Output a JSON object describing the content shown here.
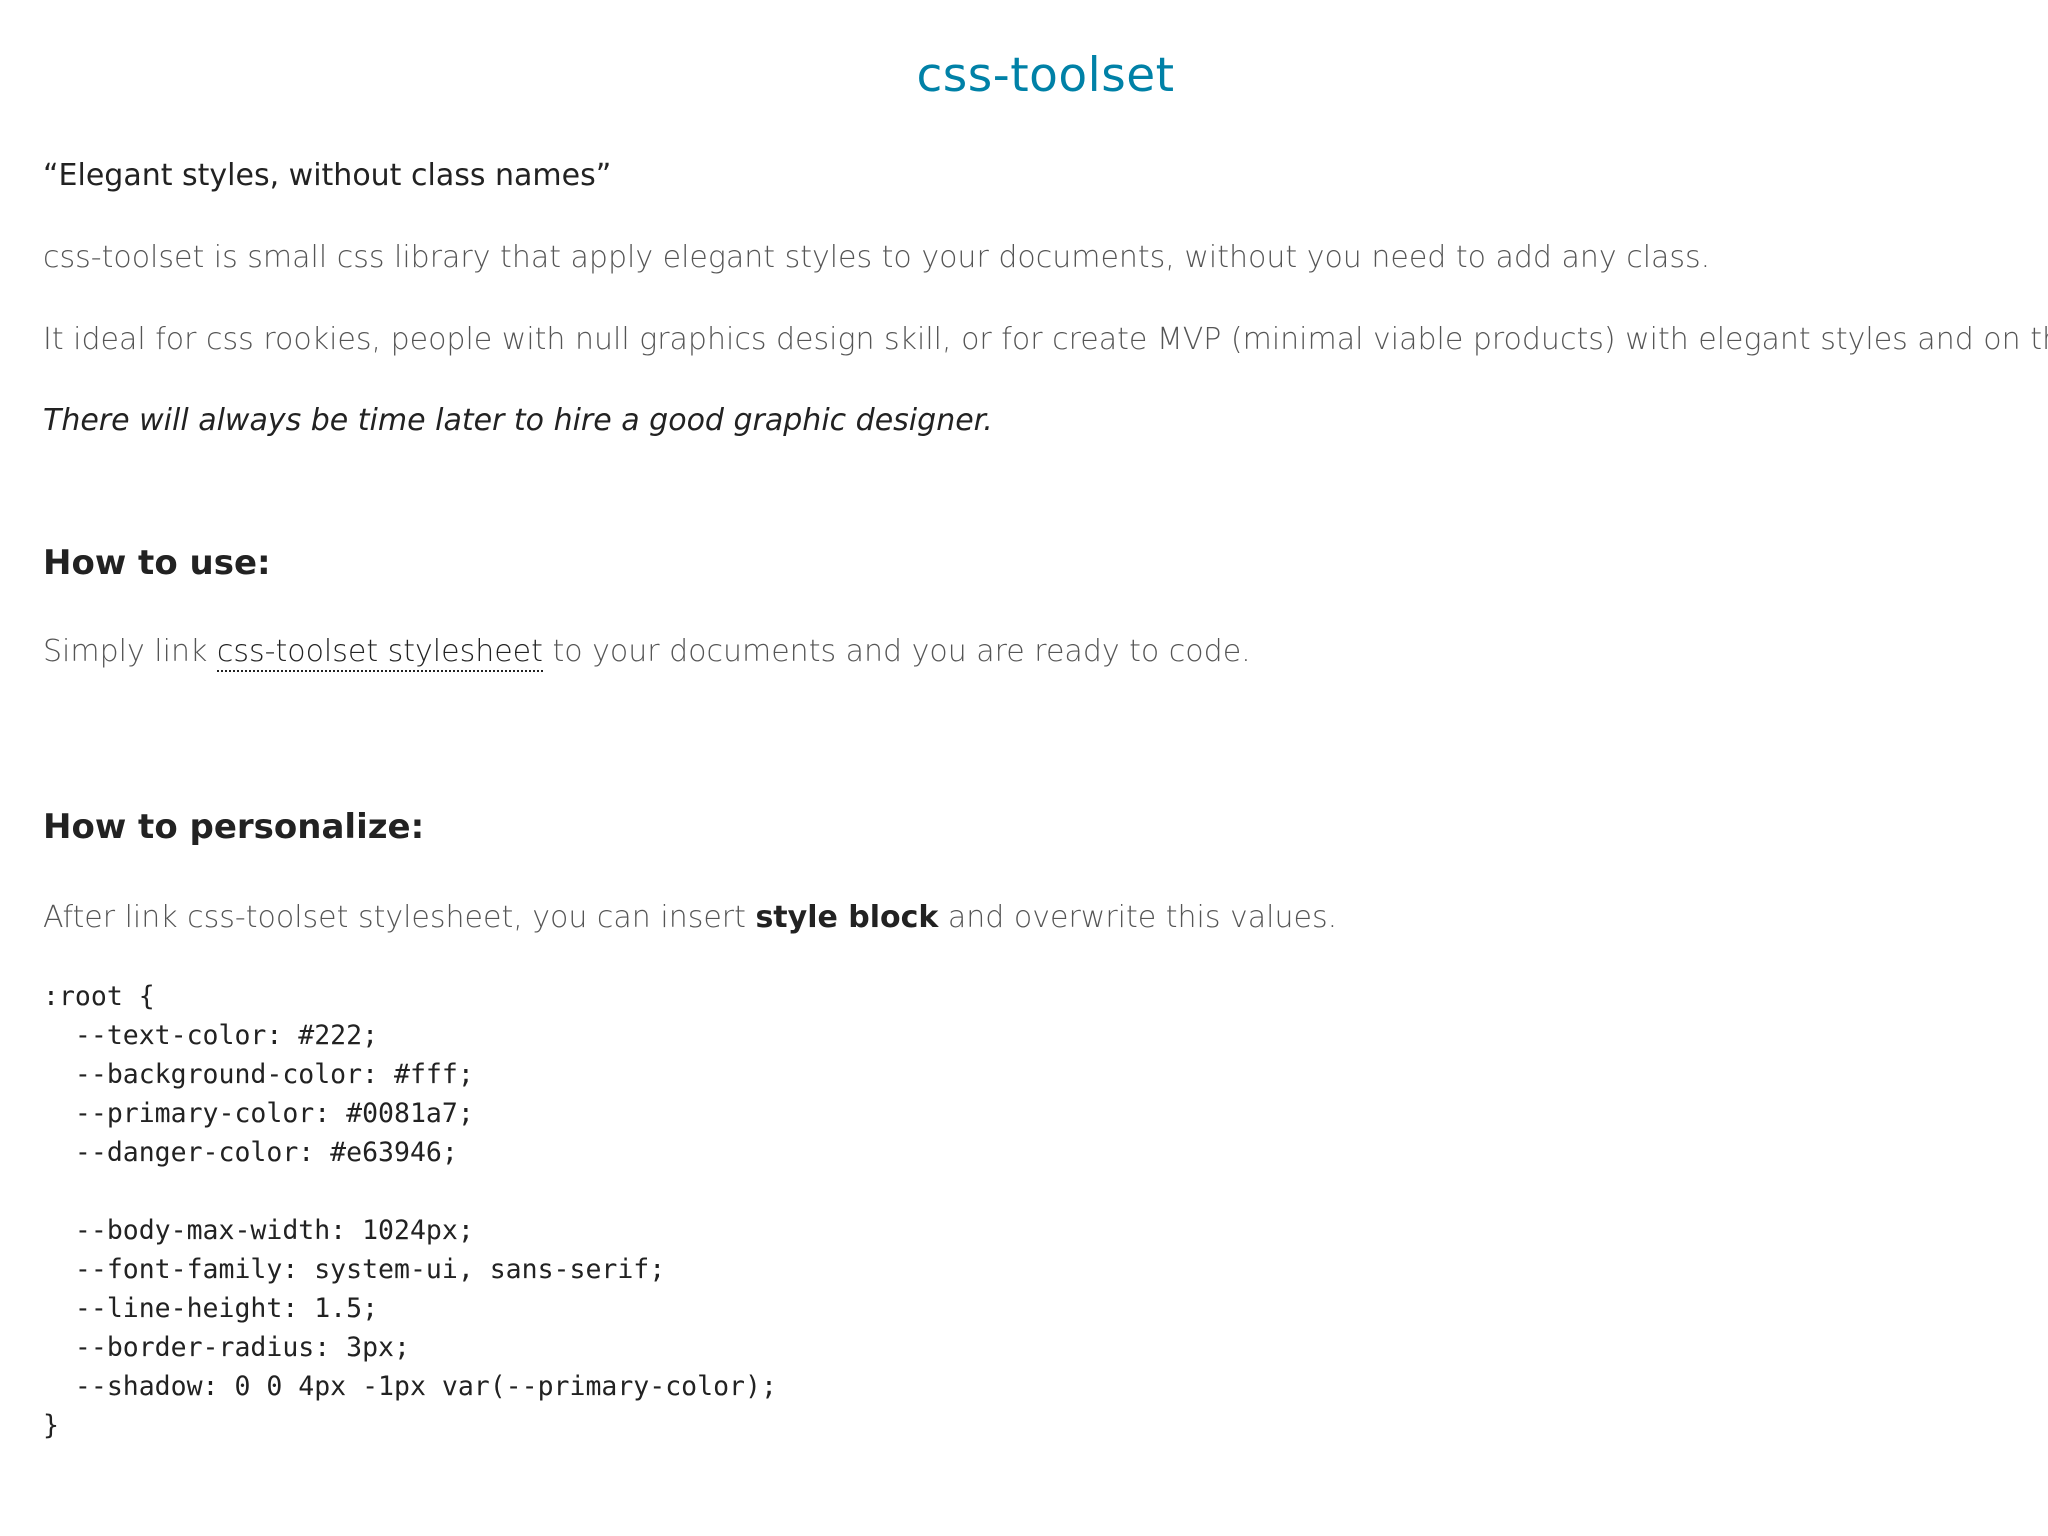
{
  "header": {
    "title": "css-toolset"
  },
  "intro": {
    "tagline": "“Elegant styles, without class names”",
    "p1": "css-toolset is small css library that apply elegant styles to your documents, without you need to add any class.",
    "p2": "It ideal for css rookies, people with null graphics design skill, or for create MVP (minimal viable products) with elegant styles and on the fly.",
    "p3": "There will always be time later to hire a good graphic designer."
  },
  "how_to_use": {
    "heading": "How to use:",
    "text_before": "Simply link ",
    "link_label": "css-toolset stylesheet",
    "text_after": " to your documents and you are ready to code."
  },
  "how_to_personalize": {
    "heading": "How to personalize:",
    "text_before": "After link css-toolset stylesheet, you can insert ",
    "bold_label": "style block",
    "text_after": " and overwrite this values."
  },
  "code": {
    "lines": [
      ":root {",
      "  --text-color: #222;",
      "  --background-color: #fff;",
      "  --primary-color: #0081a7;",
      "  --danger-color: #e63946;",
      "",
      "  --body-max-width: 1024px;",
      "  --font-family: system-ui, sans-serif;",
      "  --line-height: 1.5;",
      "  --border-radius: 3px;",
      "  --shadow: 0 0 4px -1px var(--primary-color);",
      "}"
    ]
  },
  "colors": {
    "primary": "#0081a7",
    "text": "#222222",
    "muted_text": "#555555",
    "background": "#ffffff"
  }
}
